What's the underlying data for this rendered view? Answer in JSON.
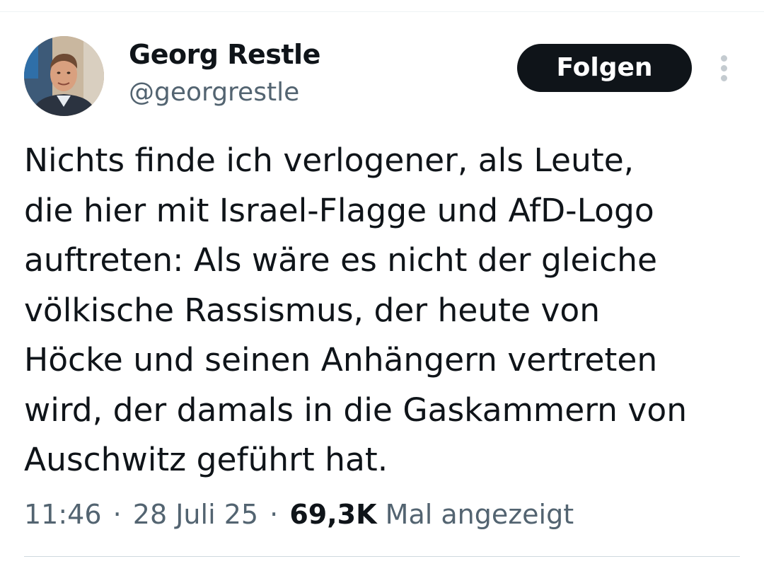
{
  "author": {
    "display_name": "Georg Restle",
    "handle": "@georgrestle",
    "avatar_icon": "profile-photo"
  },
  "actions": {
    "follow_label": "Folgen",
    "more_icon": "vertical-ellipsis-icon"
  },
  "tweet": {
    "lines": [
      "Nichts finde ich verlogener, als Leute,",
      "die hier mit Israel-Flagge und AfD-Logo",
      "auftreten: Als wäre es nicht der gleiche",
      "völkische Rassismus, der heute von",
      "Höcke und seinen Anhängern vertreten",
      "wird, der damals in die Gaskammern von",
      "Auschwitz geführt hat."
    ]
  },
  "meta": {
    "time": "11:46",
    "separator": "·",
    "date": "28 Juli 25",
    "views_count": "69,3K",
    "views_label": "Mal angezeigt"
  },
  "colors": {
    "primary_text": "#0f1419",
    "secondary_text": "#536471",
    "button_bg": "#0f1419",
    "button_text": "#ffffff",
    "divider": "#cfd9de"
  }
}
